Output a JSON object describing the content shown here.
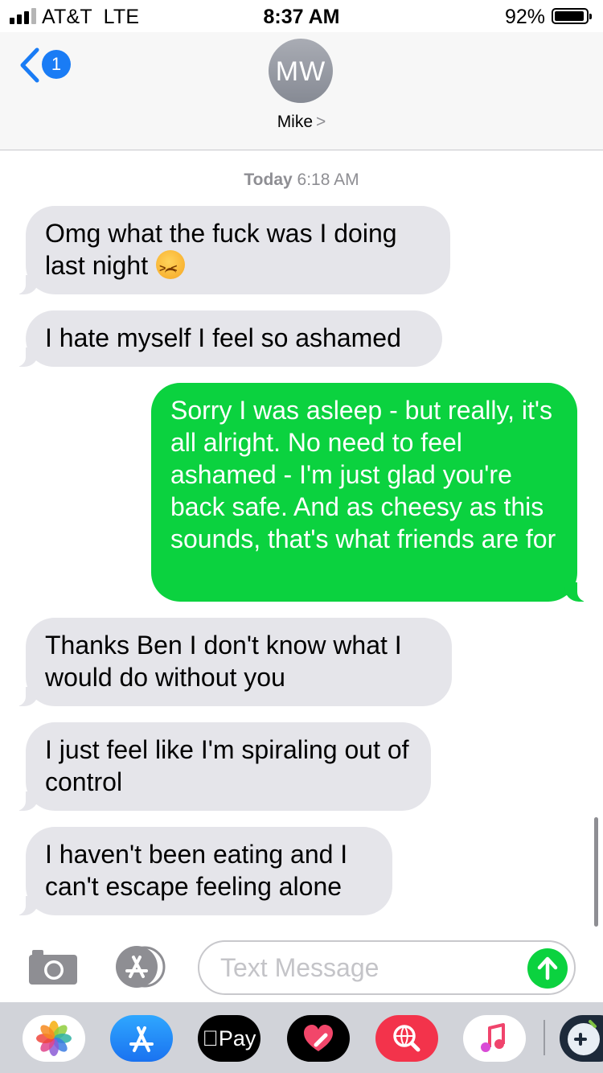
{
  "status_bar": {
    "carrier": "AT&T  LTE",
    "time": "8:37 AM",
    "battery_percent": "92%",
    "battery_level": 0.92,
    "signal_bars_filled": 3,
    "signal_bars_total": 4
  },
  "header": {
    "back_badge": "1",
    "avatar_initials": "MW",
    "contact_name": "Mike",
    "contact_chevron": ">"
  },
  "thread": {
    "timestamp_day": "Today",
    "timestamp_time": "6:18 AM",
    "messages": [
      {
        "direction": "incoming",
        "text": "Omg what the fuck was I doing last night",
        "emoji": "persevering-face"
      },
      {
        "direction": "incoming",
        "text": "I hate myself I feel so ashamed"
      },
      {
        "direction": "outgoing",
        "text": "Sorry I was asleep - but really, it's all alright. No need to feel ashamed - I'm just glad you're back safe. And as cheesy as this sounds, that's what friends are for"
      },
      {
        "direction": "incoming",
        "text": "Thanks Ben I don't know what I would do without you"
      },
      {
        "direction": "incoming",
        "text": "I just feel like I'm spiraling out of control"
      },
      {
        "direction": "incoming",
        "text": "I haven't been eating and I can't escape feeling alone"
      }
    ]
  },
  "composer": {
    "placeholder": "Text Message",
    "value": "",
    "icons": [
      "camera-icon",
      "app-store-icon",
      "send-arrow-icon"
    ]
  },
  "app_drawer": {
    "apps": [
      {
        "name": "photos",
        "icon": "photos-icon"
      },
      {
        "name": "app-store",
        "icon": "app-store-icon"
      },
      {
        "name": "apple-pay",
        "label": "Pay",
        "icon": "apple-logo-icon"
      },
      {
        "name": "digital-touch",
        "icon": "heart-icon"
      },
      {
        "name": "images-search",
        "icon": "globe-search-icon"
      },
      {
        "name": "music",
        "icon": "music-note-icon"
      },
      {
        "name": "game",
        "icon": "game-controller-icon"
      }
    ]
  },
  "colors": {
    "outgoing_bubble": "#0bd23f",
    "incoming_bubble": "#e5e5ea",
    "accent_blue": "#1a7cf5",
    "secondary_text": "#8e8e93"
  }
}
